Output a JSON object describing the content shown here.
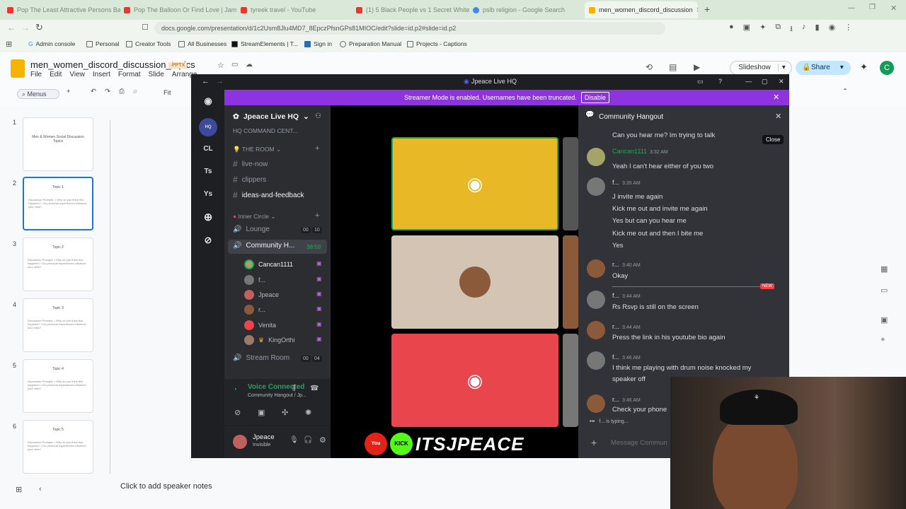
{
  "browser": {
    "tabs": [
      {
        "label": "Pop The Least Attractive Persons Ba",
        "color": "#e53935"
      },
      {
        "label": "Pop The Balloon Or Find Love | Jam",
        "color": "#e53935"
      },
      {
        "label": "tyreek travel - YouTube",
        "color": "#e53935"
      },
      {
        "label": "(1) 5 Black People vs 1 Secret White",
        "color": "#e53935"
      },
      {
        "label": "pslb religion - Google Search",
        "color": "#4285f4"
      },
      {
        "label": "men_women_discord_discussion",
        "color": "#f4b400"
      }
    ],
    "url": "docs.google.com/presentation/d/1c2Usm8Jlu4MD7_8EpczPfsnGPs81MIOC/edit?slide=id.p2#slide=id.p2",
    "bookmarks": [
      "Admin console",
      "Personal",
      "Creator Tools",
      "All Businesses",
      "StreamElements | T...",
      "Sign in",
      "Preparation Manual",
      "Projects - Captions"
    ]
  },
  "slides": {
    "title": "men_women_discord_discussion_topics",
    "badge": ".PPTX",
    "menu": [
      "File",
      "Edit",
      "View",
      "Insert",
      "Format",
      "Slide",
      "Arrange"
    ],
    "toolbar": {
      "menus": "Menus",
      "fit": "Fit"
    },
    "slideshow": "Slideshow",
    "share": "Share",
    "avatar": "C",
    "thumbnails": [
      {
        "num": "1",
        "title": "Men & Women Social Discussion Topics"
      },
      {
        "num": "2",
        "title": "Topic 1"
      },
      {
        "num": "3",
        "title": "Topic 2"
      },
      {
        "num": "4",
        "title": "Topic 3"
      },
      {
        "num": "5",
        "title": "Topic 4"
      },
      {
        "num": "6",
        "title": "Topic 5"
      }
    ],
    "thumb_lines": "Discussion Prompts:  • Why do you think this happens?  • Do personal experiences influence your view?",
    "notes": "Click to add speaker notes"
  },
  "discord": {
    "window_title": "Jpeace Live HQ",
    "streamer_banner": "Streamer Mode is enabled. Usernames have been truncated.",
    "disable": "Disable",
    "guilds": [
      "CL",
      "Ts",
      "Ys"
    ],
    "server_name": "Jpeace Live HQ",
    "truncated_category": "HQ COMMAND CENT...",
    "category_room": "THE ROOM",
    "text_channels": [
      "live-now",
      "clippers",
      "ideas-and-feedback"
    ],
    "category_inner": "Inner Circle",
    "voice_channels": [
      {
        "name": "Lounge",
        "a": "00",
        "b": "10"
      },
      {
        "name": "Community H...",
        "time": "38:59"
      },
      {
        "name": "Stream Room",
        "a": "00",
        "b": "04"
      }
    ],
    "voice_users": [
      "Cancan1111",
      "f...",
      "Jpeace",
      "r...",
      "Venita",
      "KingOrthi"
    ],
    "voice_status": "Voice Connected",
    "voice_sub": "Community Hangout / Jp...",
    "user_name": "Jpeace",
    "user_status": "Invisible",
    "stream_brand": "ITSJPEACE",
    "chat_title": "Community Hangout",
    "close_tooltip": "Close",
    "new_label": "NEW",
    "messages": [
      {
        "text": "Can you hear me? Im trying to talk"
      },
      {
        "author": "Cancan1111",
        "time": "3:32 AM",
        "text": "Yeah I can't hear either of you two"
      },
      {
        "author": "f...",
        "time": "3:35 AM",
        "text": "J invite me again"
      },
      {
        "text": "Kick me out and invite me again"
      },
      {
        "text": "Yes but can you hear me"
      },
      {
        "text": "Kick me out and then I bite me"
      },
      {
        "text": "Yes"
      },
      {
        "author": "r...",
        "time": "3:40 AM",
        "text": "Okay"
      },
      {
        "author": "f...",
        "time": "3:44 AM",
        "text": "Rs Rsvp is still on the screen"
      },
      {
        "author": "r...",
        "time": "3:44 AM",
        "text": "Press the link in his youtube bio again"
      },
      {
        "author": "f...",
        "time": "3:46 AM",
        "text": "I think me playing with drum noise knocked my"
      },
      {
        "text": "speaker off"
      },
      {
        "author": "r...",
        "time": "3:46 AM",
        "text": "Check your phone"
      }
    ],
    "typing": "f... is typing...",
    "input_placeholder": "Message Commun"
  },
  "colors": {
    "discord_purple": "#8e33e0",
    "tile_yellow": "#e8b826",
    "tile_red": "#e8454c",
    "tile_beige": "#d4c4b4",
    "accent_green": "#23a559"
  }
}
